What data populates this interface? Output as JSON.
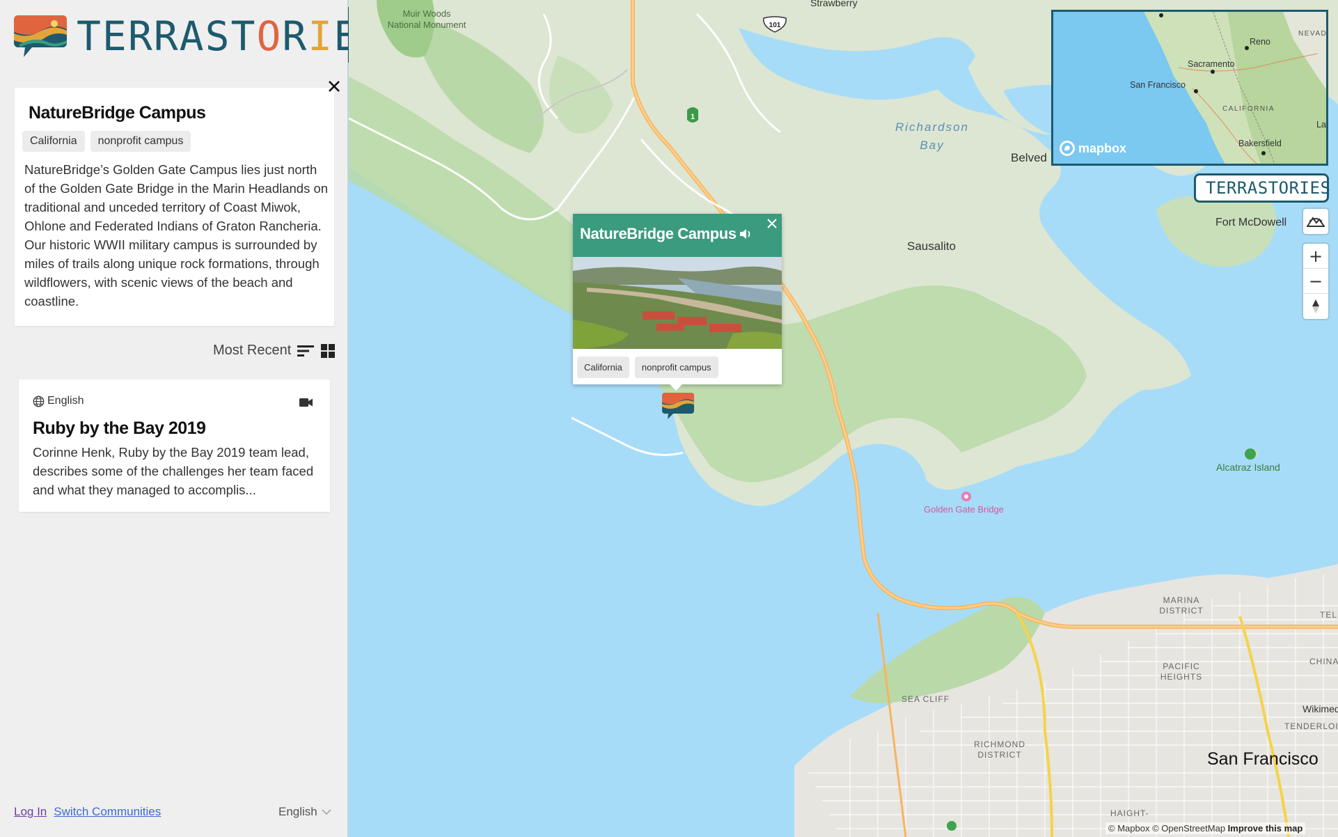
{
  "app": {
    "logo_text_parts": [
      "TERRAST",
      "O",
      "R",
      "I",
      "ES"
    ],
    "brand_color": "#1d5a6e",
    "accent_green": "#3a9b7e"
  },
  "sidebar": {
    "place": {
      "title": "NatureBridge Campus",
      "tags": [
        "California",
        "nonprofit campus"
      ],
      "description": "NatureBridge’s Golden Gate Campus lies just north of the Golden Gate Bridge in the Marin Headlands on traditional and unceded territory of Coast Miwok, Ohlone and Federated Indians of Graton Rancheria. Our historic WWII military campus is surrounded by miles of trails along unique rock formations, through wildflowers, with scenic views of the beach and coastline.",
      "close_icon": "close-icon"
    },
    "sort": {
      "label": "Most Recent"
    },
    "stories": [
      {
        "language": "English",
        "title": "Ruby by the Bay 2019",
        "description": "Corinne Henk, Ruby by the Bay 2019 team lead, describes some of the challenges her team faced and what they managed to accomplis...",
        "media_icon": "video-icon"
      }
    ],
    "footer": {
      "login": "Log In",
      "switch": "Switch Communities",
      "language": "English"
    }
  },
  "map": {
    "labels": {
      "muir_woods": "Muir Woods National Monument",
      "strawberry": "Strawberry",
      "hwy101": "101",
      "hwy1": "1",
      "richardson_bay": "Richardson Bay",
      "belvedere": "Belved",
      "sausalito": "Sausalito",
      "fort_mcdowell": "Fort McDowell",
      "alcatraz": "Alcatraz Island",
      "golden_gate": "Golden Gate Bridge",
      "marina": "MARINA DISTRICT",
      "pacific_heights": "PACIFIC HEIGHTS",
      "chinatown": "CHINA",
      "telegraph": "TELE",
      "wikimedia": "Wikimed",
      "tenderloin": "TENDERLOIN",
      "sea_cliff": "SEA CLIFF",
      "richmond": "RICHMOND DISTRICT",
      "haight": "HAIGHT-",
      "san_francisco": "San Francisco"
    },
    "popup": {
      "title": "NatureBridge Campus",
      "tags": [
        "California",
        "nonprofit campus"
      ]
    },
    "minimap": {
      "labels": {
        "reno": "Reno",
        "nevada": "NEVADA",
        "sacramento": "Sacramento",
        "san_francisco": "San Francisco",
        "california": "CALIFORNIA",
        "bakersfield": "Bakersfield",
        "la": "La"
      },
      "logo": "mapbox"
    },
    "badge": "TERRASTORIES",
    "controls": {
      "zoom_in": "+",
      "zoom_out": "−"
    },
    "attribution": {
      "mapbox": "© Mapbox",
      "osm": "© OpenStreetMap",
      "improve": "Improve this map"
    }
  }
}
